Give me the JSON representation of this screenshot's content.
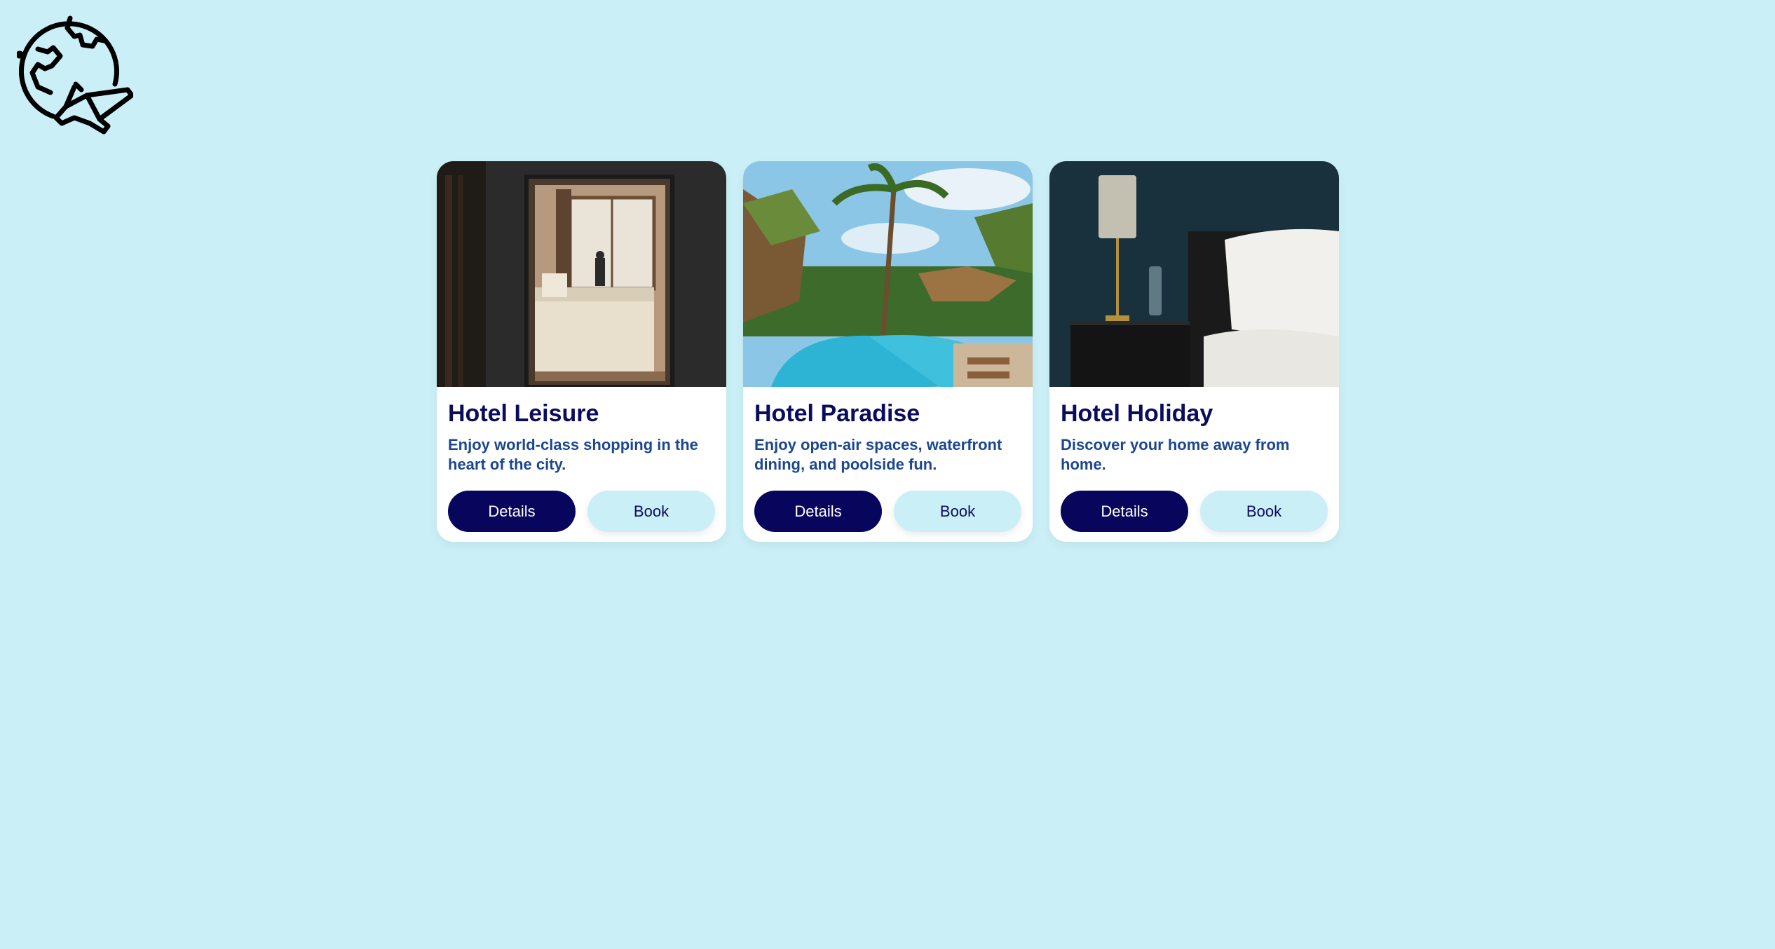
{
  "logo": {
    "icon": "globe-airplane-icon"
  },
  "colors": {
    "background": "#caeff7",
    "primary_button": "#07065c",
    "title": "#0b0d5c",
    "description": "#1a4790"
  },
  "cards": [
    {
      "title": "Hotel Leisure",
      "description": "Enjoy world-class shopping in the heart of the city.",
      "image": "hotel-room-window-image",
      "details_label": "Details",
      "book_label": "Book"
    },
    {
      "title": "Hotel Paradise",
      "description": "Enjoy open-air spaces, waterfront dining, and poolside fun.",
      "image": "tropical-pool-palms-image",
      "details_label": "Details",
      "book_label": "Book"
    },
    {
      "title": "Hotel Holiday",
      "description": "Discover your home away from home.",
      "image": "bedside-lamp-image",
      "details_label": "Details",
      "book_label": "Book"
    }
  ]
}
